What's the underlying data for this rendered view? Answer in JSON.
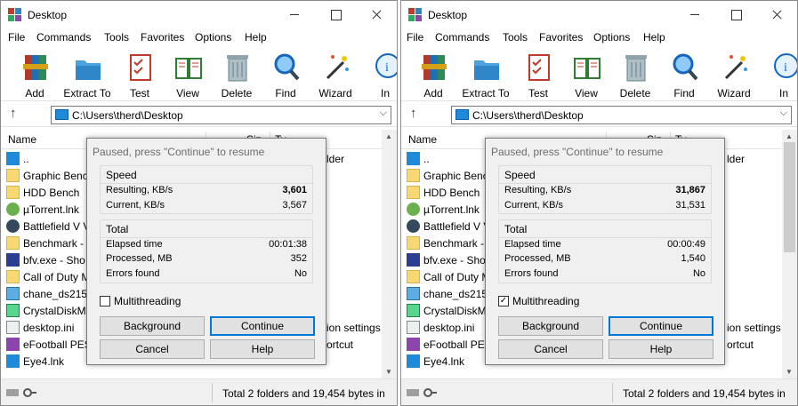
{
  "windows": [
    {
      "title": "Desktop",
      "menu": [
        "File",
        "Commands",
        "Tools",
        "Favorites",
        "Options",
        "Help"
      ],
      "toolbar": [
        "Add",
        "Extract To",
        "Test",
        "View",
        "Delete",
        "Find",
        "Wizard",
        "In"
      ],
      "address": "C:\\Users\\therd\\Desktop",
      "column_name": "Name",
      "column_fragments": [
        "Siz",
        "Ty"
      ],
      "files": [
        {
          "name": "..",
          "icon": "up-folder-icon"
        },
        {
          "name": "Graphic Benc",
          "icon": "folder-icon"
        },
        {
          "name": "HDD Bench",
          "icon": "folder-icon"
        },
        {
          "name": "µTorrent.lnk",
          "icon": "utorrent-icon"
        },
        {
          "name": "Battlefield V V",
          "icon": "battlefield-icon"
        },
        {
          "name": "Benchmark -",
          "icon": "folder-icon"
        },
        {
          "name": "bfv.exe - Sho",
          "icon": "bfv-icon"
        },
        {
          "name": "Call of Duty M",
          "icon": "cod-icon"
        },
        {
          "name": "chane_ds215j",
          "icon": "screen-icon"
        },
        {
          "name": "CrystalDiskMa",
          "icon": "crystaldisk-icon"
        },
        {
          "name": "desktop.ini",
          "icon": "ini-file-icon"
        },
        {
          "name": "eFootball PES",
          "icon": "pes-icon"
        },
        {
          "name": "Eye4.lnk",
          "icon": "eye4-icon"
        }
      ],
      "right_fragments": [
        "lder",
        "ion settings",
        "ortcut"
      ],
      "status": "Total 2 folders and 19,454 bytes in",
      "dialog": {
        "title": "Paused, press \"Continue\" to resume",
        "speed_label": "Speed",
        "resulting_label": "Resulting, KB/s",
        "resulting_value": "3,601",
        "current_label": "Current, KB/s",
        "current_value": "3,567",
        "total_label": "Total",
        "elapsed_label": "Elapsed time",
        "elapsed_value": "00:01:38",
        "processed_label": "Processed, MB",
        "processed_value": "352",
        "errors_label": "Errors found",
        "errors_value": "No",
        "multithreading_label": "Multithreading",
        "multithreading_checked": "",
        "background_label": "Background",
        "continue_label": "Continue",
        "cancel_label": "Cancel",
        "help_label": "Help"
      }
    },
    {
      "title": "Desktop",
      "menu": [
        "File",
        "Commands",
        "Tools",
        "Favorites",
        "Options",
        "Help"
      ],
      "toolbar": [
        "Add",
        "Extract To",
        "Test",
        "View",
        "Delete",
        "Find",
        "Wizard",
        "In"
      ],
      "address": "C:\\Users\\therd\\Desktop",
      "column_name": "Name",
      "column_fragments": [
        "Siz",
        "Ty"
      ],
      "files": [
        {
          "name": "..",
          "icon": "up-folder-icon"
        },
        {
          "name": "Graphic Benc",
          "icon": "folder-icon"
        },
        {
          "name": "HDD Bench",
          "icon": "folder-icon"
        },
        {
          "name": "µTorrent.lnk",
          "icon": "utorrent-icon"
        },
        {
          "name": "Battlefield V V",
          "icon": "battlefield-icon"
        },
        {
          "name": "Benchmark -",
          "icon": "folder-icon"
        },
        {
          "name": "bfv.exe - Sho",
          "icon": "bfv-icon"
        },
        {
          "name": "Call of Duty M",
          "icon": "cod-icon"
        },
        {
          "name": "chane_ds215j",
          "icon": "screen-icon"
        },
        {
          "name": "CrystalDiskMa",
          "icon": "crystaldisk-icon"
        },
        {
          "name": "desktop.ini",
          "icon": "ini-file-icon"
        },
        {
          "name": "eFootball PES",
          "icon": "pes-icon"
        },
        {
          "name": "Eye4.lnk",
          "icon": "eye4-icon"
        }
      ],
      "right_fragments": [
        "lder",
        "ion settings",
        "ortcut"
      ],
      "status": "Total 2 folders and 19,454 bytes in",
      "dialog": {
        "title": "Paused, press \"Continue\" to resume",
        "speed_label": "Speed",
        "resulting_label": "Resulting, KB/s",
        "resulting_value": "31,867",
        "current_label": "Current, KB/s",
        "current_value": "31,531",
        "total_label": "Total",
        "elapsed_label": "Elapsed time",
        "elapsed_value": "00:00:49",
        "processed_label": "Processed, MB",
        "processed_value": "1,540",
        "errors_label": "Errors found",
        "errors_value": "No",
        "multithreading_label": "Multithreading",
        "multithreading_checked": "✓",
        "background_label": "Background",
        "continue_label": "Continue",
        "cancel_label": "Cancel",
        "help_label": "Help"
      }
    }
  ],
  "colors": {
    "accent": "#0078d7",
    "folder": "#f8d775",
    "dialog_bg": "#f0f0f0"
  }
}
